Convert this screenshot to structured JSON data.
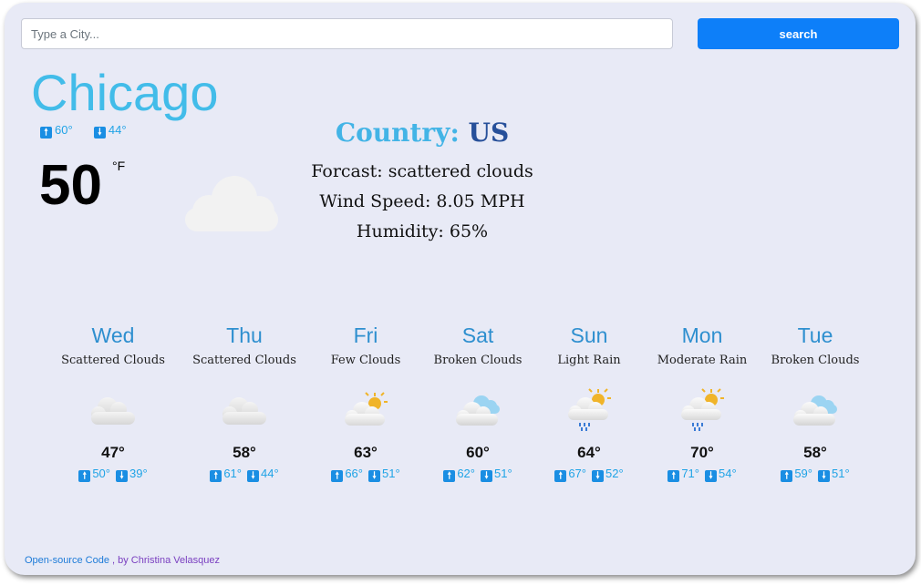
{
  "search": {
    "placeholder": "Type a City...",
    "value": "",
    "button_label": "search"
  },
  "current": {
    "city": "Chicago",
    "max": "60°",
    "min": "44°",
    "temperature": "50",
    "unit": "°F",
    "icon": "cloud-icon",
    "country_label": "Country:",
    "country": "US",
    "forecast_line": "Forcast: scattered clouds",
    "wind_line": "Wind Speed: 8.05 MPH",
    "humidity_line": "Humidity: 65%"
  },
  "forecast": [
    {
      "day": "Wed",
      "desc": "Scattered Clouds",
      "icon": "scattered-clouds-icon",
      "temp": "47°",
      "max": "50°",
      "min": "39°"
    },
    {
      "day": "Thu",
      "desc": "Scattered Clouds",
      "icon": "scattered-clouds-icon",
      "temp": "58°",
      "max": "61°",
      "min": "44°"
    },
    {
      "day": "Fri",
      "desc": "Few Clouds",
      "icon": "sun-cloud-icon",
      "temp": "63°",
      "max": "66°",
      "min": "51°"
    },
    {
      "day": "Sat",
      "desc": "Broken Clouds",
      "icon": "broken-clouds-icon",
      "temp": "60°",
      "max": "62°",
      "min": "51°"
    },
    {
      "day": "Sun",
      "desc": "Light Rain",
      "icon": "sun-rain-icon",
      "temp": "64°",
      "max": "67°",
      "min": "52°"
    },
    {
      "day": "Mon",
      "desc": "Moderate Rain",
      "icon": "sun-rain-icon",
      "temp": "70°",
      "max": "71°",
      "min": "54°"
    },
    {
      "day": "Tue",
      "desc": "Broken Clouds",
      "icon": "broken-clouds-icon",
      "temp": "58°",
      "max": "59°",
      "min": "51°"
    }
  ],
  "footer": {
    "code_link": "Open-source Code",
    "separator": " , by ",
    "author": "Christina Velasquez"
  },
  "colors": {
    "accent": "#42bce9",
    "button": "#0d7ff9",
    "card_bg": "#e8eaf6",
    "arrow_box": "#1a8ee3",
    "country_value": "#27509a"
  }
}
